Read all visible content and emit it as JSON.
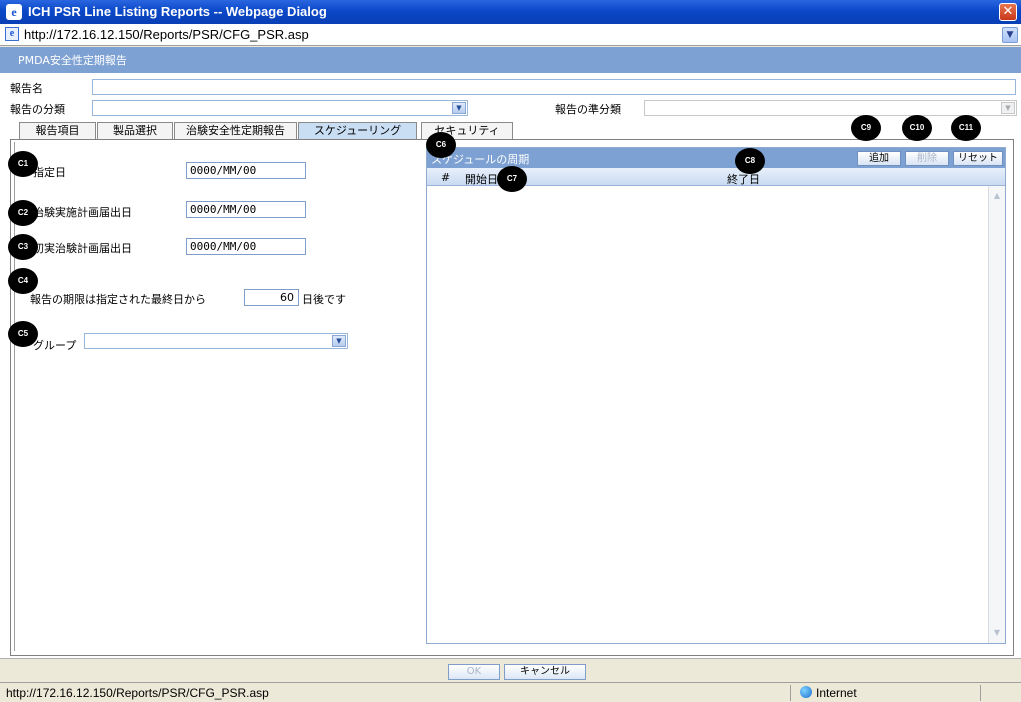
{
  "window": {
    "title": "ICH PSR Line Listing Reports -- Webpage Dialog",
    "close_glyph": "✕",
    "app_icon_glyph": "e"
  },
  "address": {
    "url": "http://172.16.12.150/Reports/PSR/CFG_PSR.asp",
    "dropdown_glyph": "▼"
  },
  "header": {
    "title": "PMDA安全性定期報告"
  },
  "form": {
    "report_name_label": "報告名",
    "report_name_value": "",
    "report_category_label": "報告の分類",
    "report_category_value": "",
    "report_subcategory_label": "報告の準分類",
    "report_subcategory_value": ""
  },
  "tabs": [
    {
      "label": "報告項目"
    },
    {
      "label": "製品選択"
    },
    {
      "label": "治験安全性定期報告"
    },
    {
      "label": "スケジューリング"
    },
    {
      "label": "セキュリティ"
    }
  ],
  "schedule_left": {
    "designated_date_label": "指定日",
    "designated_date_value": "0000/MM/00",
    "trial_plan_date_label": "治験実施計画届出日",
    "trial_plan_date_value": "0000/MM/00",
    "first_trial_plan_date_label": "初実治験計画届出日",
    "first_trial_plan_date_value": "0000/MM/00",
    "period_text_prefix": "報告の期限は指定された最終日から",
    "period_days": "60",
    "period_text_suffix": "日後です",
    "group_label": "グループ",
    "group_value": ""
  },
  "schedule_panel": {
    "title": "スケジュールの周期",
    "add_button": "追加",
    "delete_button": "削除",
    "reset_button": "リセット",
    "columns": [
      "#",
      "開始日",
      "終了日"
    ]
  },
  "callouts": [
    "C1",
    "C2",
    "C3",
    "C4",
    "C5",
    "C6",
    "C7",
    "C8",
    "C9",
    "C10",
    "C11"
  ],
  "footer": {
    "ok_button": "OK",
    "cancel_button": "キャンセル"
  },
  "status": {
    "url": "http://172.16.12.150/Reports/PSR/CFG_PSR.asp",
    "zone": "Internet"
  },
  "colors": {
    "title_bar": "#0a48c8",
    "header_bar": "#7ea1d3",
    "callout": "#000000"
  }
}
